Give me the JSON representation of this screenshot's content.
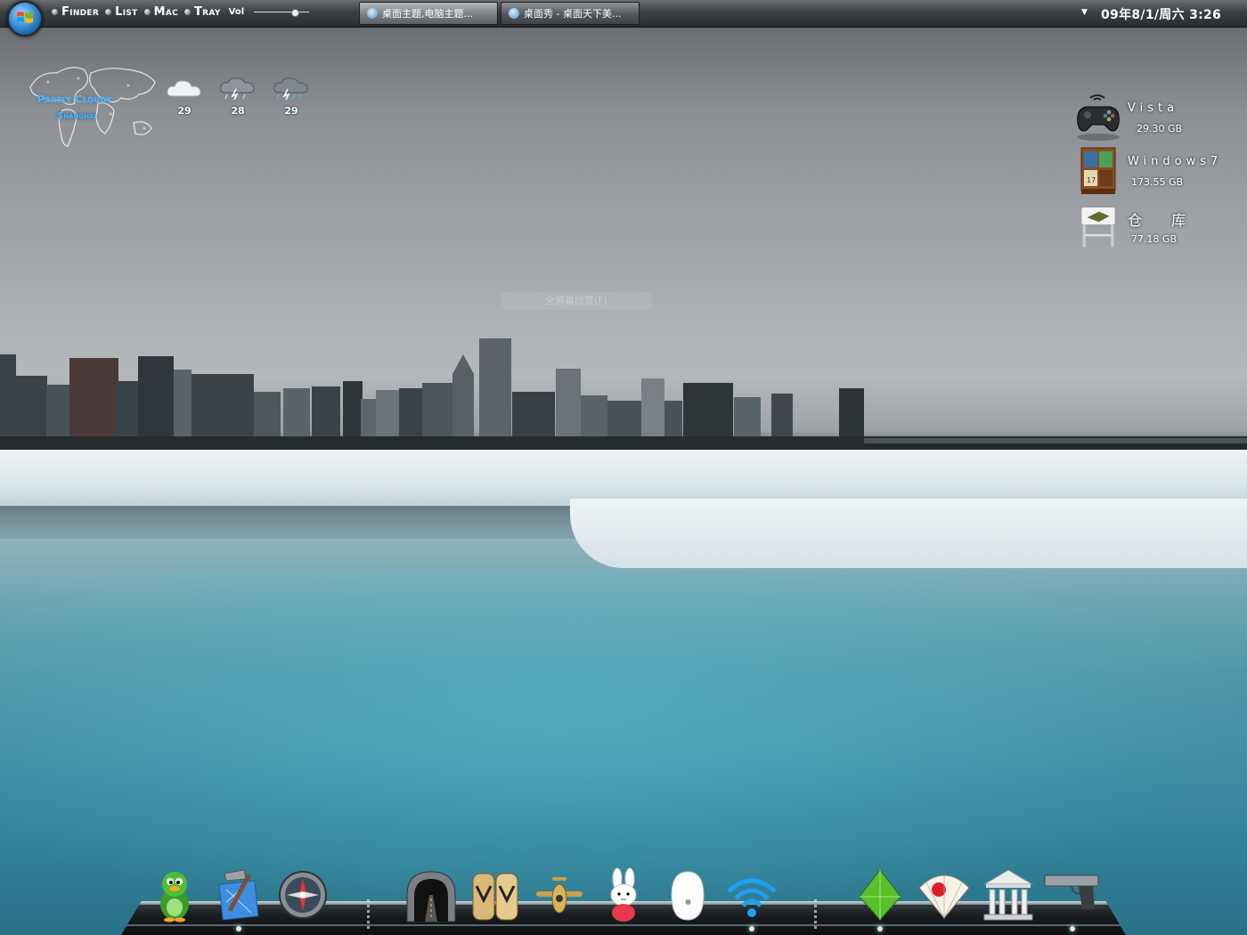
{
  "topbar": {
    "menu": [
      {
        "label": "Finder"
      },
      {
        "label": "List"
      },
      {
        "label": "Mac"
      },
      {
        "label": "Tray"
      }
    ],
    "volume_label": "Vol",
    "volume_level": 0.75,
    "tasks": [
      {
        "label": "桌面主题,电脑主题...",
        "active": true
      },
      {
        "label": "桌面秀 - 桌面天下美...",
        "active": false
      }
    ],
    "clock": "09年8/1/周六 3:26"
  },
  "weather": {
    "condition": "Partly Cloudy",
    "city": "Shanghai",
    "forecast": [
      {
        "icon": "cloud-icon",
        "temp": "29"
      },
      {
        "icon": "thunderstorm-icon",
        "temp": "28"
      },
      {
        "icon": "thunderstorm-rain-icon",
        "temp": "29"
      }
    ]
  },
  "drives": [
    {
      "name": "Vista",
      "size": "29.30 GB",
      "icon": "gamepad-icon"
    },
    {
      "name": "Windows7",
      "size": "173.55 GB",
      "icon": "bookshelf-icon"
    },
    {
      "name": "仓 库",
      "size": "77.18 GB",
      "icon": "tray-stand-icon"
    }
  ],
  "center_hint": "全屏幕欣赏(F)",
  "dock": [
    {
      "name": "qq-penguin-icon",
      "running": false
    },
    {
      "name": "xcode-hammer-icon",
      "running": true
    },
    {
      "name": "compass-icon",
      "running": false
    },
    {
      "name": "tunnel-icon",
      "running": false
    },
    {
      "name": "sandals-icon",
      "running": false
    },
    {
      "name": "airplane-icon",
      "running": false
    },
    {
      "name": "bunny-icon",
      "running": false
    },
    {
      "name": "mouse-icon",
      "running": false
    },
    {
      "name": "wifi-icon",
      "running": true
    },
    {
      "name": "green-crystal-icon",
      "running": true
    },
    {
      "name": "japanese-fan-icon",
      "running": false
    },
    {
      "name": "bank-building-icon",
      "running": false
    },
    {
      "name": "pistol-icon",
      "running": true
    }
  ],
  "colors": {
    "accent_weather": "#49b9ff",
    "topbar": "#3d4043"
  }
}
